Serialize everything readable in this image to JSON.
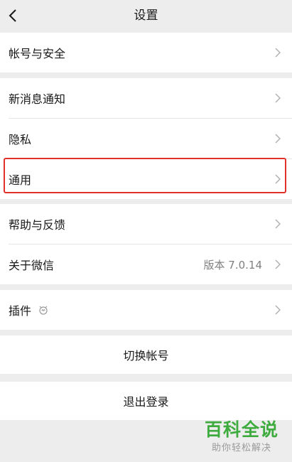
{
  "nav": {
    "title": "设置"
  },
  "group1": {
    "items": [
      {
        "label": "帐号与安全"
      }
    ]
  },
  "group2": {
    "items": [
      {
        "label": "新消息通知"
      },
      {
        "label": "隐私"
      },
      {
        "label": "通用"
      }
    ]
  },
  "group3": {
    "items": [
      {
        "label": "帮助与反馈"
      },
      {
        "label": "关于微信",
        "value": "版本 7.0.14"
      }
    ]
  },
  "group4": {
    "items": [
      {
        "label": "插件"
      }
    ]
  },
  "actions": {
    "switch_account": "切换帐号",
    "logout": "退出登录"
  },
  "watermark": {
    "title": "百科全说",
    "subtitle": "助你轻松解决"
  },
  "colors": {
    "highlight": "#e0312b",
    "watermark_green": "#3dab3d"
  },
  "icons": {
    "back": "chevron-left-icon",
    "row_arrow": "chevron-right-icon",
    "plugin": "plugin-icon"
  }
}
